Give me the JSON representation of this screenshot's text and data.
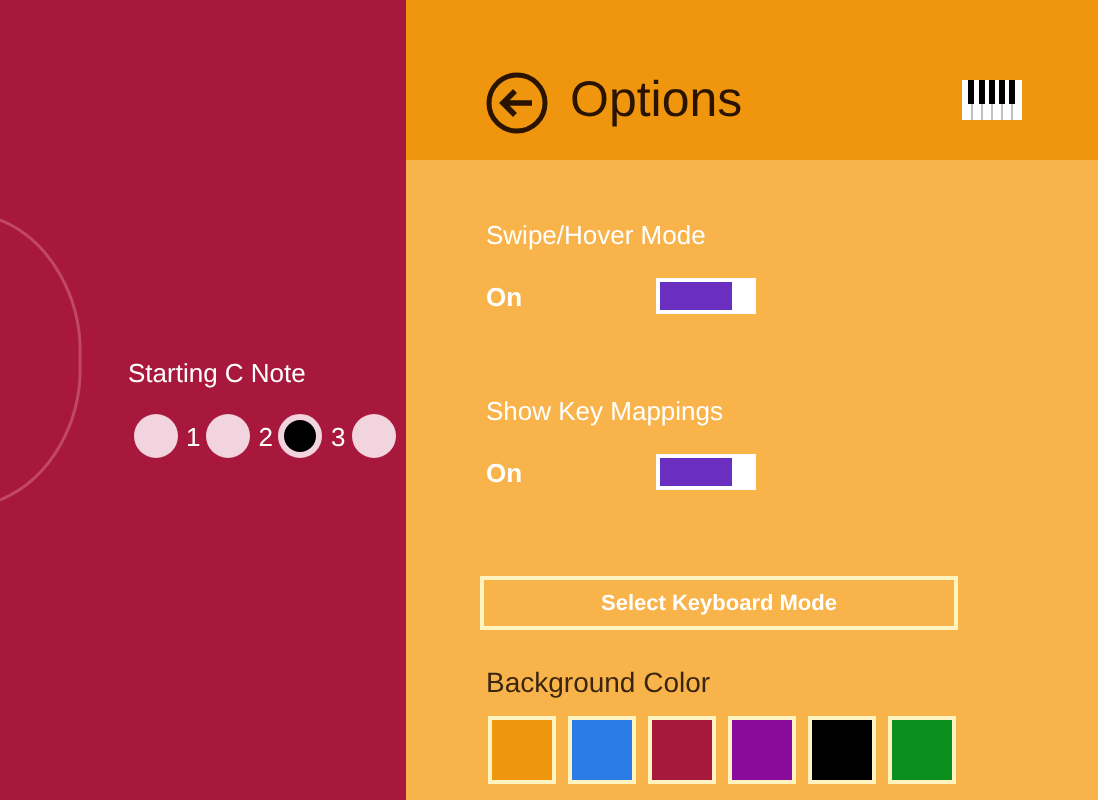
{
  "starting_note": {
    "label": "Starting C Note",
    "options": [
      {
        "label": "1",
        "selected": false
      },
      {
        "label": "2",
        "selected": false
      },
      {
        "label": "3",
        "selected": true
      },
      {
        "selected": false
      }
    ]
  },
  "panel": {
    "title": "Options",
    "settings": [
      {
        "label": "Swipe/Hover Mode",
        "value": "On",
        "on": true
      },
      {
        "label": "Show Key Mappings",
        "value": "On",
        "on": true
      }
    ],
    "button": "Select Keyboard Mode",
    "background_color": {
      "label": "Background Color",
      "swatches": [
        {
          "color": "#f0960e"
        },
        {
          "color": "#2d7be6"
        },
        {
          "color": "#a8183c"
        },
        {
          "color": "#8a0a9c"
        },
        {
          "color": "#000000"
        },
        {
          "color": "#0a8f1e"
        }
      ]
    }
  }
}
